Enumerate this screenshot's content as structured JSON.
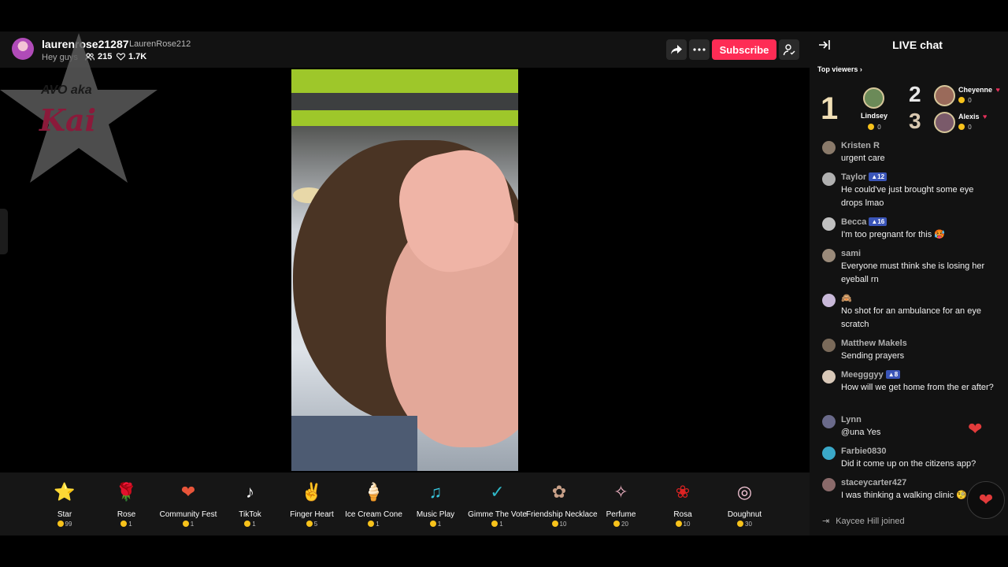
{
  "header": {
    "host_name": "laurenrose21287",
    "host_handle": "LaurenRose212",
    "stream_title": "Hey guys",
    "viewer_count": "215",
    "like_count": "1.7K",
    "subscribe_label": "Subscribe",
    "icons": [
      "share-icon",
      "more-icon",
      "profile-icon",
      "viewers-icon",
      "heart-icon"
    ]
  },
  "overlay_logo": {
    "line1": "AVO aka",
    "line2": "Kai"
  },
  "gifts": [
    {
      "name": "Star",
      "cost": "99",
      "icon": "star"
    },
    {
      "name": "Rose",
      "cost": "1",
      "icon": "rose"
    },
    {
      "name": "Community Fest",
      "cost": "1",
      "icon": "community-fest"
    },
    {
      "name": "TikTok",
      "cost": "1",
      "icon": "tiktok"
    },
    {
      "name": "Finger Heart",
      "cost": "5",
      "icon": "finger-heart"
    },
    {
      "name": "Ice Cream Cone",
      "cost": "1",
      "icon": "ice-cream"
    },
    {
      "name": "Music Play",
      "cost": "1",
      "icon": "music-play"
    },
    {
      "name": "Gimme The Vote",
      "cost": "1",
      "icon": "vote"
    },
    {
      "name": "Friendship Necklace",
      "cost": "10",
      "icon": "necklace"
    },
    {
      "name": "Perfume",
      "cost": "20",
      "icon": "perfume"
    },
    {
      "name": "Rosa",
      "cost": "10",
      "icon": "rosa"
    },
    {
      "name": "Doughnut",
      "cost": "30",
      "icon": "doughnut"
    }
  ],
  "chat": {
    "title": "LIVE chat",
    "top_viewers_label": "Top viewers",
    "top_viewers": [
      {
        "rank": "1",
        "name": "Lindsey",
        "score": "0"
      },
      {
        "rank": "2",
        "name": "Cheyenne",
        "score": "0"
      },
      {
        "rank": "3",
        "name": "Alexis",
        "score": "0"
      }
    ],
    "messages": [
      {
        "user": "Kristen R",
        "text": "urgent care",
        "badge": "",
        "color": "#8a7a6a"
      },
      {
        "user": "Taylor",
        "text": "He could've just brought some eye drops lmao",
        "badge": "12",
        "color": "#b0b0b0"
      },
      {
        "user": "Becca",
        "text": "I'm too pregnant for this 🥵",
        "badge": "16",
        "color": "#c0c0c0"
      },
      {
        "user": "sami",
        "text": "Everyone must think she is losing her eyeball rn",
        "badge": "",
        "color": "#9a8a7a"
      },
      {
        "user": "🙈",
        "text": "No shot for an ambulance for an eye scratch",
        "badge": "",
        "color": "#c8b8d8"
      },
      {
        "user": "Matthew Makels",
        "text": "Sending prayers",
        "badge": "",
        "color": "#7a6a5a"
      },
      {
        "user": "Meegggyy",
        "text": "How will we get home from the er after?",
        "badge": "8",
        "color": "#d8c8b8"
      },
      {
        "user": "Lynn",
        "text": "@una Yes",
        "badge": "",
        "color": "#6a6a8a"
      },
      {
        "user": "Farbie0830",
        "text": "Did it come up on the citizens app?",
        "badge": "",
        "color": "#3aa8c8"
      },
      {
        "user": "staceycarter427",
        "text": "I was thinking a walking clinic 🧐",
        "badge": "",
        "color": "#8a6a6a"
      }
    ],
    "join_text": "Kaycee Hill joined"
  }
}
